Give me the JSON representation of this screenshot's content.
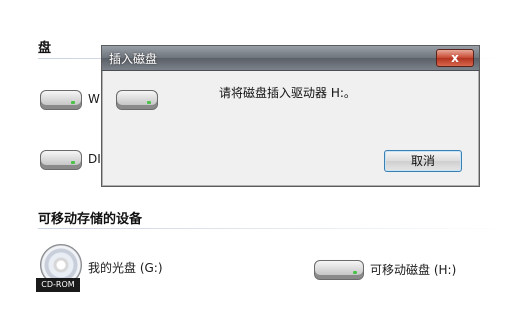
{
  "background": {
    "section_partial_title": "盘",
    "drive_w_label_partial": "W",
    "drive_d_label_partial": "DI",
    "removable_section_title": "可移动存储的设备",
    "cd_drive_label": "我的光盘 (G:)",
    "cd_badge": "CD-ROM",
    "removable_disk_label": "可移动磁盘 (H:)"
  },
  "dialog": {
    "title": "插入磁盘",
    "close_label": "x",
    "message": "请将磁盘插入驱动器 H:。",
    "cancel_label": "取消"
  },
  "colors": {
    "dialog_bg": "#f0f0f0",
    "titlebar": "#6e747c",
    "close_button": "#c6472f",
    "button_border": "#3c7fb1"
  },
  "icons": [
    "hard-drive-icon",
    "cd-drive-icon",
    "removable-disk-icon",
    "close-icon"
  ]
}
